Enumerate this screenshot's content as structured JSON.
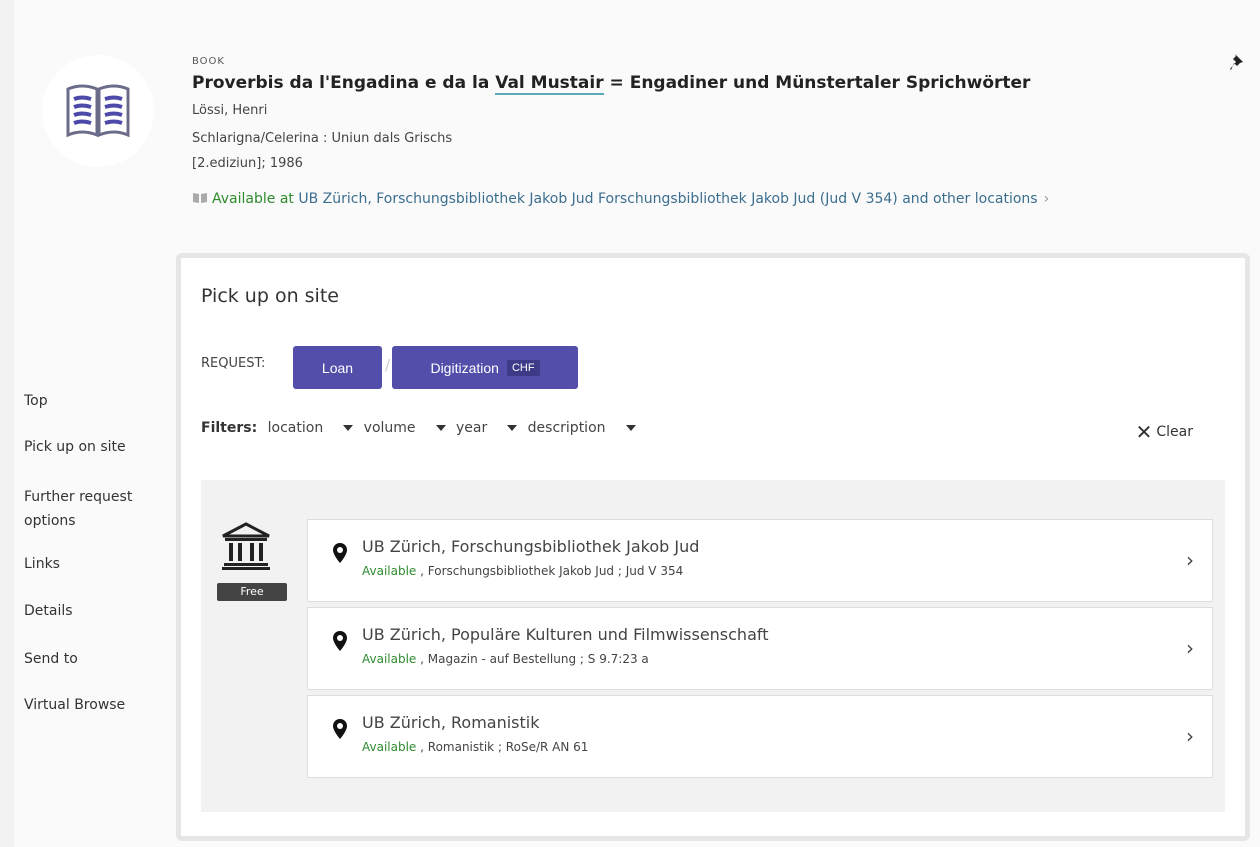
{
  "side_nav": [
    "Top",
    "Pick up on site",
    "Further request options",
    "Links",
    "Details",
    "Send to",
    "Virtual Browse"
  ],
  "record": {
    "type": "BOOK",
    "title_pre": "Proverbis da l'Engadina e da la ",
    "title_underlined": "Val Mustair",
    "title_post": " = Engadiner und Münstertaler Sprichwörter",
    "author": "Lössi, Henri",
    "publisher": "Schlarigna/Celerina : Uniun dals Grischs",
    "edition": "[2.ediziun]; 1986",
    "availability_status": "Available at",
    "availability_location": "UB Zürich, Forschungsbibliothek Jakob Jud  Forschungsbibliothek Jakob Jud (Jud V 354) and other locations",
    "book_icon": "book-open-icon",
    "pin_icon": "pushpin-icon"
  },
  "panel": {
    "title": "Pick up on site",
    "request_label": "REQUEST:",
    "loan_label": "Loan",
    "digitization_label": "Digitization",
    "chf_badge": "CHF",
    "filters_label": "Filters:",
    "filters": [
      "location",
      "volume",
      "year",
      "description"
    ],
    "clear_label": "Clear",
    "free_badge": "Free"
  },
  "locations": [
    {
      "name": "UB Zürich, Forschungsbibliothek Jakob Jud",
      "status": "Available",
      "detail": " , Forschungsbibliothek Jakob Jud ; Jud V 354"
    },
    {
      "name": "UB Zürich, Populäre Kulturen und Filmwissenschaft",
      "status": "Available",
      "detail": " , Magazin - auf Bestellung ; S 9.7:23 a"
    },
    {
      "name": "UB Zürich, Romanistik",
      "status": "Available",
      "detail": " , Romanistik ; RoSe/R AN 61"
    }
  ],
  "colors": {
    "accent": "#534eaa",
    "available": "#2e8b2e",
    "link": "#3c6e8f"
  }
}
